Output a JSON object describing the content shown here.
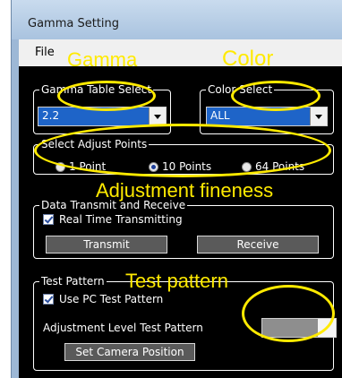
{
  "window": {
    "title": "Gamma Setting"
  },
  "menu": {
    "file": "File"
  },
  "gamma_table": {
    "legend": "Gamma Table Select",
    "value": "2.2"
  },
  "color_select": {
    "legend": "Color Select",
    "value": "ALL"
  },
  "adjust_points": {
    "legend": "Select Adjust Points",
    "options": [
      {
        "label": "1 Point",
        "selected": false
      },
      {
        "label": "10 Points",
        "selected": true
      },
      {
        "label": "64 Points",
        "selected": false
      }
    ]
  },
  "data_transmit": {
    "legend": "Data Transmit and Receive",
    "realtime_label": "Real Time Transmitting",
    "realtime_checked": true,
    "transmit_label": "Transmit",
    "receive_label": "Receive"
  },
  "test_pattern": {
    "legend": "Test Pattern",
    "use_pc_label": "Use PC Test Pattern",
    "use_pc_checked": true,
    "level_label": "Adjustment Level Test Pattern",
    "set_camera_label": "Set Camera Position"
  },
  "annotations": {
    "gamma": "Gamma",
    "color": "Color",
    "adjustment": "Adjustment fineness",
    "test_pattern": "Test pattern",
    "highlight_color": "#ffea00"
  }
}
